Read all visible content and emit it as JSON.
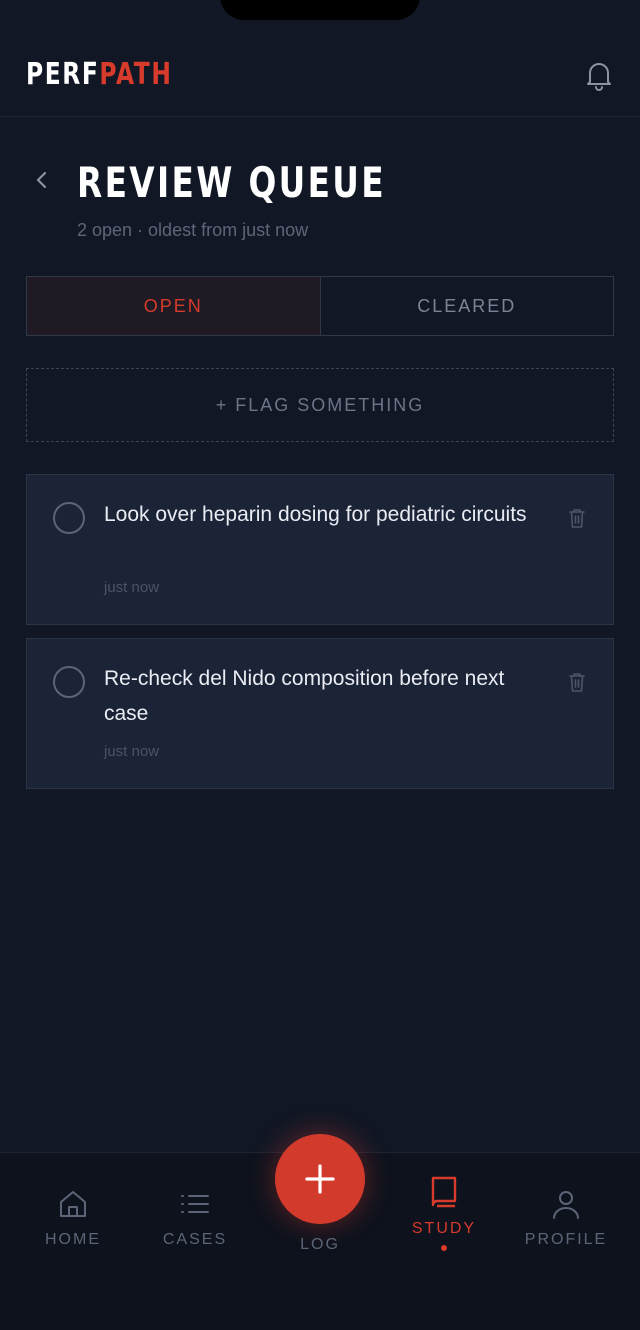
{
  "app": {
    "logo_part1": "PERF",
    "logo_part2": "PATH",
    "accent_color": "#d63b2c"
  },
  "header": {
    "bell_icon": "bell-icon"
  },
  "page": {
    "back_icon": "chevron-left-icon",
    "title": "REVIEW QUEUE",
    "subtitle": "2 open · oldest from just now"
  },
  "tabs": [
    {
      "label": "OPEN",
      "active": true
    },
    {
      "label": "CLEARED",
      "active": false
    }
  ],
  "flag_button": {
    "label": "+ FLAG SOMETHING"
  },
  "items": [
    {
      "text": "Look over heparin dosing for pediatric circuits",
      "time": "just now",
      "checked": false
    },
    {
      "text": "Re-check del Nido composition before next case",
      "time": "just now",
      "checked": false
    }
  ],
  "bottom_nav": {
    "items": [
      {
        "label": "HOME",
        "icon": "home-icon",
        "active": false
      },
      {
        "label": "CASES",
        "icon": "list-icon",
        "active": false
      },
      {
        "label": "LOG",
        "icon": "plus-icon",
        "active": false
      },
      {
        "label": "STUDY",
        "icon": "book-icon",
        "active": true
      },
      {
        "label": "PROFILE",
        "icon": "user-icon",
        "active": false
      }
    ]
  }
}
